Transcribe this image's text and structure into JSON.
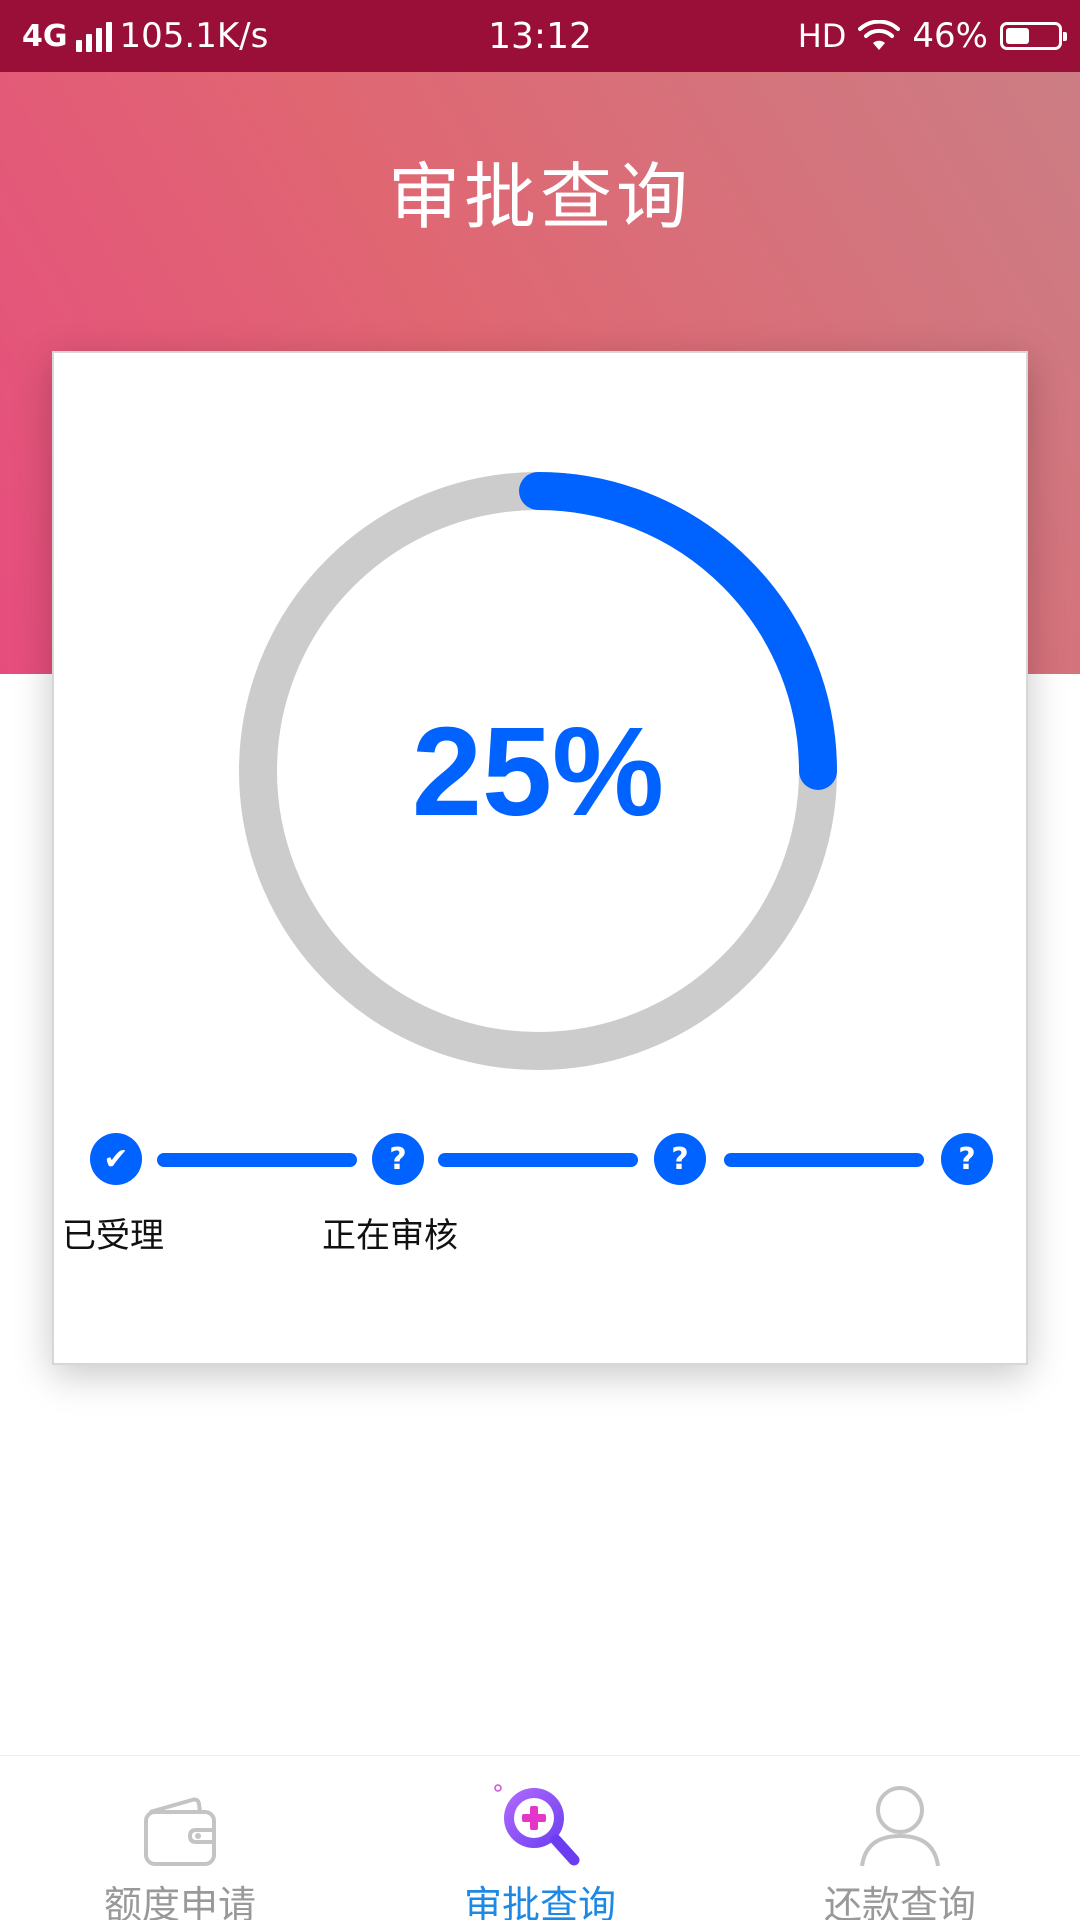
{
  "status_bar": {
    "network": "4G",
    "speed": "105.1K/s",
    "time": "13:12",
    "hd": "HD",
    "battery_percent": "46%",
    "battery_level": 0.46
  },
  "header": {
    "title": "审批查询"
  },
  "progress": {
    "value_label": "25%",
    "fraction": 0.25,
    "color": "#0062ff",
    "track_color": "#cccccc"
  },
  "steps": [
    {
      "icon": "check-icon",
      "glyph": "✔",
      "label": "已受理"
    },
    {
      "icon": "question-icon",
      "glyph": "?",
      "label": "正在审核"
    },
    {
      "icon": "question-icon",
      "glyph": "?",
      "label": ""
    },
    {
      "icon": "question-icon",
      "glyph": "?",
      "label": ""
    }
  ],
  "bottom_nav": {
    "items": [
      {
        "label": "额度申请",
        "icon": "wallet-icon",
        "active": false
      },
      {
        "label": "审批查询",
        "icon": "search-plus-icon",
        "active": true
      },
      {
        "label": "还款查询",
        "icon": "user-icon",
        "active": false
      }
    ],
    "active_color": "#1e88e5",
    "inactive_color": "#999999"
  }
}
